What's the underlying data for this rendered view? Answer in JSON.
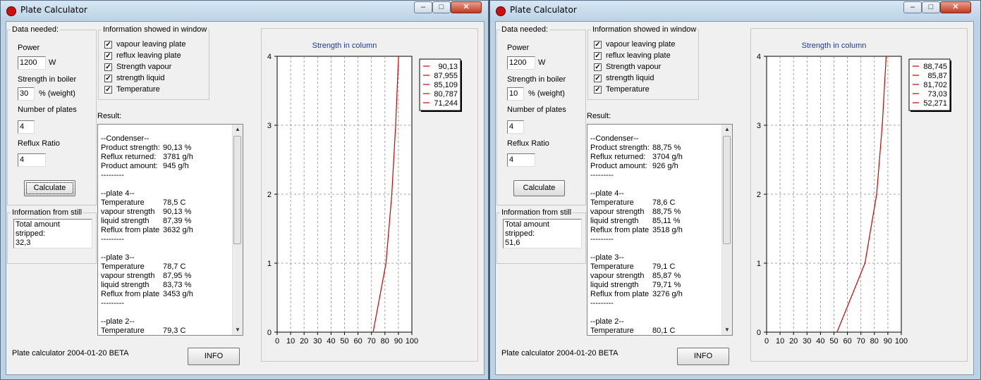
{
  "windows": [
    {
      "title": "Plate Calculator",
      "data_needed": {
        "legend": "Data needed:",
        "power_label": "Power",
        "power_value": "1200",
        "power_unit": "W",
        "strength_label": "Strength in  boiler",
        "strength_value": "30",
        "strength_unit": "% (weight)",
        "plates_label": "Number of plates",
        "plates_value": "4",
        "reflux_label": "Reflux Ratio",
        "reflux_value": "4",
        "calculate_label": "Calculate"
      },
      "info_window": {
        "legend": "Information showed in window",
        "options": [
          {
            "label": "vapour leaving plate",
            "checked": true
          },
          {
            "label": "reflux leaving plate",
            "checked": true
          },
          {
            "label": "Strength vapour",
            "checked": true
          },
          {
            "label": "strength liquid",
            "checked": true
          },
          {
            "label": "Temperature",
            "checked": true
          }
        ]
      },
      "still_info": {
        "legend": "Information from still",
        "line1": "Total amount stripped:",
        "line2": "32,3"
      },
      "result": {
        "label": "Result:",
        "lines": [
          [
            "--Condenser--",
            ""
          ],
          [
            "Product strength:",
            "90,13 %"
          ],
          [
            "Reflux returned:",
            "3781 g/h"
          ],
          [
            "Product amount:",
            "945 g/h"
          ],
          [
            "---------",
            ""
          ],
          [
            "",
            ""
          ],
          [
            "--plate 4--",
            ""
          ],
          [
            "Temperature",
            "78,5  C"
          ],
          [
            "vapour strength",
            "90,13 %"
          ],
          [
            "liquid strength",
            "87,39 %"
          ],
          [
            "Reflux from plate",
            "3632 g/h"
          ],
          [
            "---------",
            ""
          ],
          [
            "",
            ""
          ],
          [
            "--plate 3--",
            ""
          ],
          [
            "Temperature",
            "78,7  C"
          ],
          [
            "vapour strength",
            "87,95 %"
          ],
          [
            "liquid strength",
            "83,73 %"
          ],
          [
            "Reflux from plate",
            "3453 g/h"
          ],
          [
            "---------",
            ""
          ],
          [
            "",
            ""
          ],
          [
            "--plate 2--",
            ""
          ],
          [
            "Temperature",
            "79,3  C"
          ]
        ]
      },
      "footer_text": "Plate calculator 2004-01-20 BETA",
      "info_button": "INFO",
      "chart_data": {
        "type": "line",
        "title": "Strength in column",
        "x_ticks": [
          "0",
          "10",
          "20",
          "30",
          "40",
          "50",
          "60",
          "70",
          "80",
          "90",
          "100"
        ],
        "y_ticks": [
          "0",
          "1",
          "2",
          "3",
          "4"
        ],
        "xlim": [
          0,
          100
        ],
        "ylim": [
          0,
          4
        ],
        "grid": true,
        "series": [
          {
            "color": "#cc0000",
            "x": [
              71.244,
              80.787,
              85.109,
              87.955,
              90.13
            ],
            "y": [
              0,
              1,
              2,
              3,
              4
            ]
          }
        ],
        "legend": [
          "90,13",
          "87,955",
          "85,109",
          "80,787",
          "71,244"
        ],
        "legend_position": "right"
      }
    },
    {
      "title": "Plate Calculator",
      "data_needed": {
        "legend": "Data needed:",
        "power_label": "Power",
        "power_value": "1200",
        "power_unit": "W",
        "strength_label": "Strength in  boiler",
        "strength_value": "10",
        "strength_unit": "% (weight)",
        "plates_label": "Number of plates",
        "plates_value": "4",
        "reflux_label": "Reflux Ratio",
        "reflux_value": "4",
        "calculate_label": "Calculate"
      },
      "info_window": {
        "legend": "Information showed in window",
        "options": [
          {
            "label": "vapour leaving plate",
            "checked": true
          },
          {
            "label": "reflux leaving plate",
            "checked": true
          },
          {
            "label": "Strength vapour",
            "checked": true
          },
          {
            "label": "strength liquid",
            "checked": true
          },
          {
            "label": "Temperature",
            "checked": true
          }
        ]
      },
      "still_info": {
        "legend": "Information from still",
        "line1": "Total amount stripped:",
        "line2": "51,6"
      },
      "result": {
        "label": "Result:",
        "lines": [
          [
            "--Condenser--",
            ""
          ],
          [
            "Product strength:",
            "88,75 %"
          ],
          [
            "Reflux returned:",
            "3704 g/h"
          ],
          [
            "Product amount:",
            "926 g/h"
          ],
          [
            "---------",
            ""
          ],
          [
            "",
            ""
          ],
          [
            "--plate 4--",
            ""
          ],
          [
            "Temperature",
            "78,6  C"
          ],
          [
            "vapour strength",
            "88,75 %"
          ],
          [
            "liquid strength",
            "85,11 %"
          ],
          [
            "Reflux from plate",
            "3518 g/h"
          ],
          [
            "---------",
            ""
          ],
          [
            "",
            ""
          ],
          [
            "--plate 3--",
            ""
          ],
          [
            "Temperature",
            "79,1  C"
          ],
          [
            "vapour strength",
            "85,87 %"
          ],
          [
            "liquid strength",
            "79,71 %"
          ],
          [
            "Reflux from plate",
            "3276 g/h"
          ],
          [
            "---------",
            ""
          ],
          [
            "",
            ""
          ],
          [
            "--plate 2--",
            ""
          ],
          [
            "Temperature",
            "80,1  C"
          ]
        ]
      },
      "footer_text": "Plate calculator 2004-01-20 BETA",
      "info_button": "INFO",
      "chart_data": {
        "type": "line",
        "title": "Strength in column",
        "x_ticks": [
          "0",
          "10",
          "20",
          "30",
          "40",
          "50",
          "60",
          "70",
          "80",
          "90",
          "100"
        ],
        "y_ticks": [
          "0",
          "1",
          "2",
          "3",
          "4"
        ],
        "xlim": [
          0,
          100
        ],
        "ylim": [
          0,
          4
        ],
        "grid": true,
        "series": [
          {
            "color": "#cc0000",
            "x": [
              52.271,
              73.03,
              81.702,
              85.87,
              88.745
            ],
            "y": [
              0,
              1,
              2,
              3,
              4
            ]
          }
        ],
        "legend": [
          "88,745",
          "85,87",
          "81,702",
          "73,03",
          "52,271"
        ],
        "legend_position": "right"
      }
    }
  ]
}
